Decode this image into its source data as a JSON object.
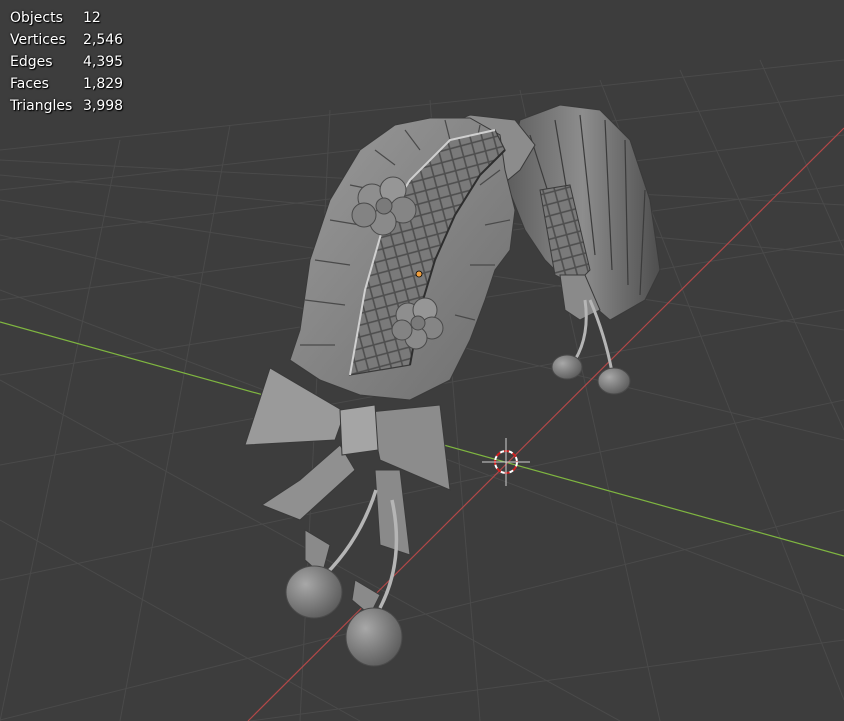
{
  "viewport": {
    "background": "#3d3d3d",
    "grid_color": "#4a4a4a",
    "x_axis_color": "#b34848",
    "y_axis_color": "#7fb640"
  },
  "stats": {
    "rows": [
      {
        "label": "Objects",
        "value": "12"
      },
      {
        "label": "Vertices",
        "value": "2,546"
      },
      {
        "label": "Edges",
        "value": "4,395"
      },
      {
        "label": "Faces",
        "value": "1,829"
      },
      {
        "label": "Triangles",
        "value": "3,998"
      }
    ]
  },
  "scene": {
    "model": "headdress-bonnet",
    "cursor_icon": "3d-cursor-icon",
    "origin_icon": "object-origin-icon"
  }
}
